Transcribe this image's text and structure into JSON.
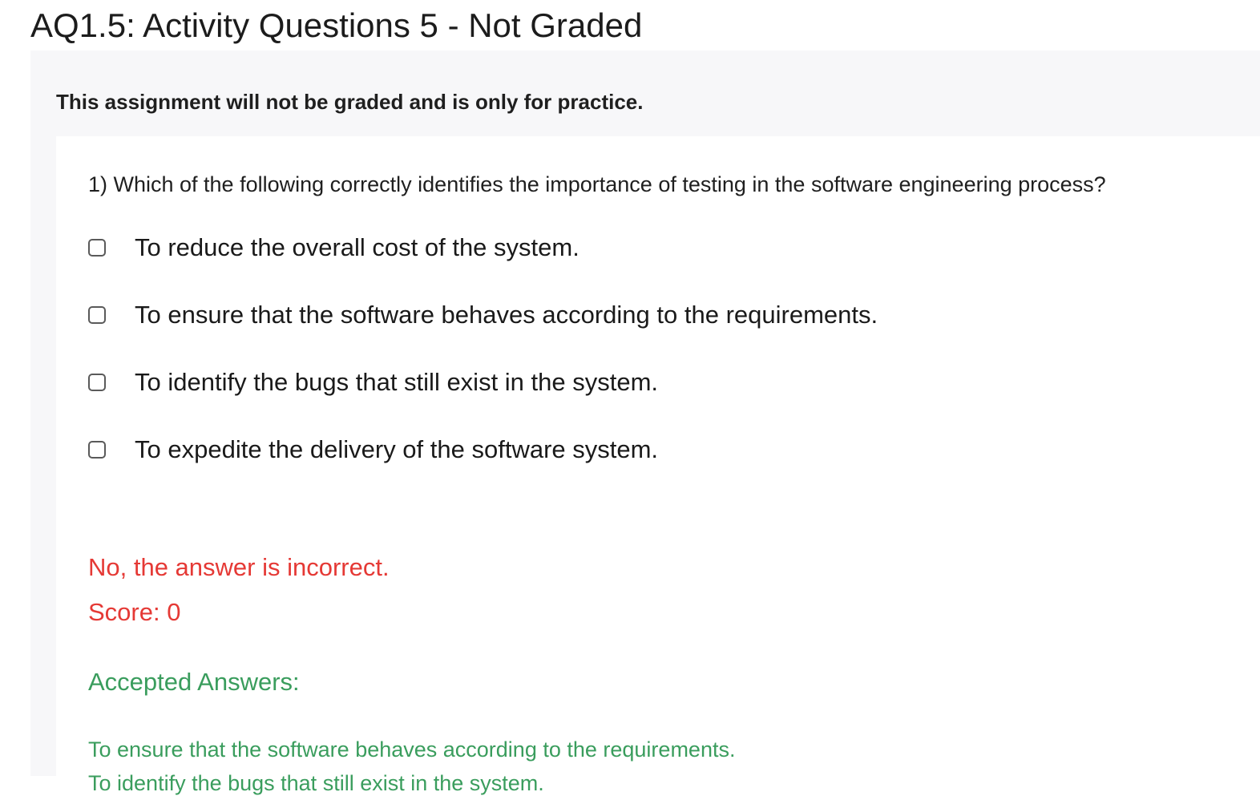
{
  "page": {
    "title": "AQ1.5: Activity Questions 5 - Not Graded"
  },
  "notice": {
    "text": "This assignment will not be graded and is only for practice."
  },
  "question": {
    "text": "1) Which of the following correctly identifies the importance of testing in the software engineering process?",
    "options": [
      {
        "label": "To reduce the overall cost of the system.",
        "checked": false
      },
      {
        "label": "To ensure that the software behaves according to the requirements.",
        "checked": false
      },
      {
        "label": "To identify the bugs that still exist in the system.",
        "checked": false
      },
      {
        "label": "To expedite the delivery of the software system.",
        "checked": false
      }
    ]
  },
  "result": {
    "feedback": "No, the answer is incorrect.",
    "score": "Score: 0",
    "accepted_heading": "Accepted Answers:",
    "accepted_answers": [
      "To ensure that the software behaves according to the requirements.",
      "To identify the bugs that still exist in the system."
    ]
  },
  "colors": {
    "incorrect": "#e53935",
    "accepted": "#3a9d5d",
    "panel_background": "#f7f7f9"
  },
  "icons": {
    "option_checkbox": "checkbox-icon"
  }
}
